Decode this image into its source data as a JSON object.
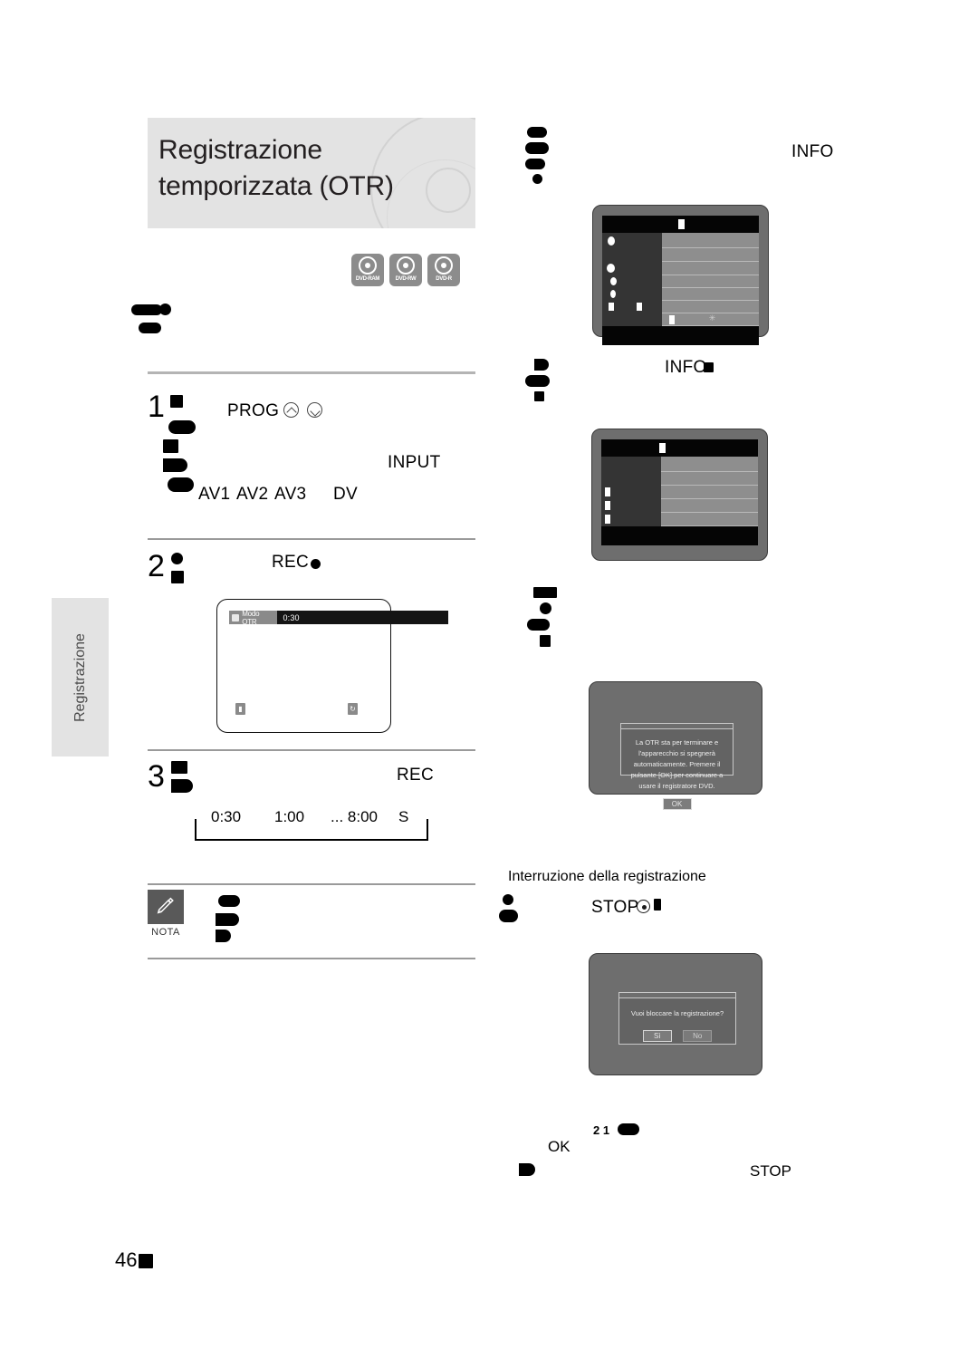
{
  "page": {
    "number": "46",
    "side_tab": "Registrazione"
  },
  "header": {
    "title": "Registrazione\ntemporizzata (OTR)",
    "disc_badges": [
      {
        "label": "DVD-RAM"
      },
      {
        "label": "DVD-RW"
      },
      {
        "label": "DVD-R"
      }
    ]
  },
  "left_column": {
    "steps": [
      {
        "number": "1",
        "keys": {
          "prog": "PROG",
          "input": "INPUT"
        },
        "sources": [
          "AV1",
          "AV2",
          "AV3",
          "DV"
        ]
      },
      {
        "number": "2",
        "key": "REC",
        "screen": {
          "mode_label": "Modo OTR",
          "time": "0:30"
        }
      },
      {
        "number": "3",
        "key": "REC",
        "durations": [
          "0:30",
          "1:00",
          "... 8:00",
          "S"
        ]
      }
    ],
    "note": {
      "label": "NOTA"
    }
  },
  "right_column": {
    "info_key": "INFO",
    "info_key_2": "INFO.",
    "stop_section": {
      "heading": "Interruzione della registrazione",
      "key": "STOP"
    },
    "otr_end_dialog": {
      "message": "La OTR sta per terminare e l'apparecchio si spegnerà automaticamente. Premere il pulsante [OK] per continuare a usare il registratore DVD.",
      "ok_label": "OK"
    },
    "stop_confirm_dialog": {
      "message": "Vuoi bloccare la registrazione?",
      "yes_label": "Sì",
      "no_label": "No"
    },
    "footer_keys": {
      "counter": "2 1",
      "ok": "OK",
      "stop": "STOP"
    }
  },
  "colors": {
    "band": "#e3e3e3",
    "rule": "#b4b4b4",
    "badge": "#8c8c8c",
    "screen_bg": "#6e6e6e"
  }
}
